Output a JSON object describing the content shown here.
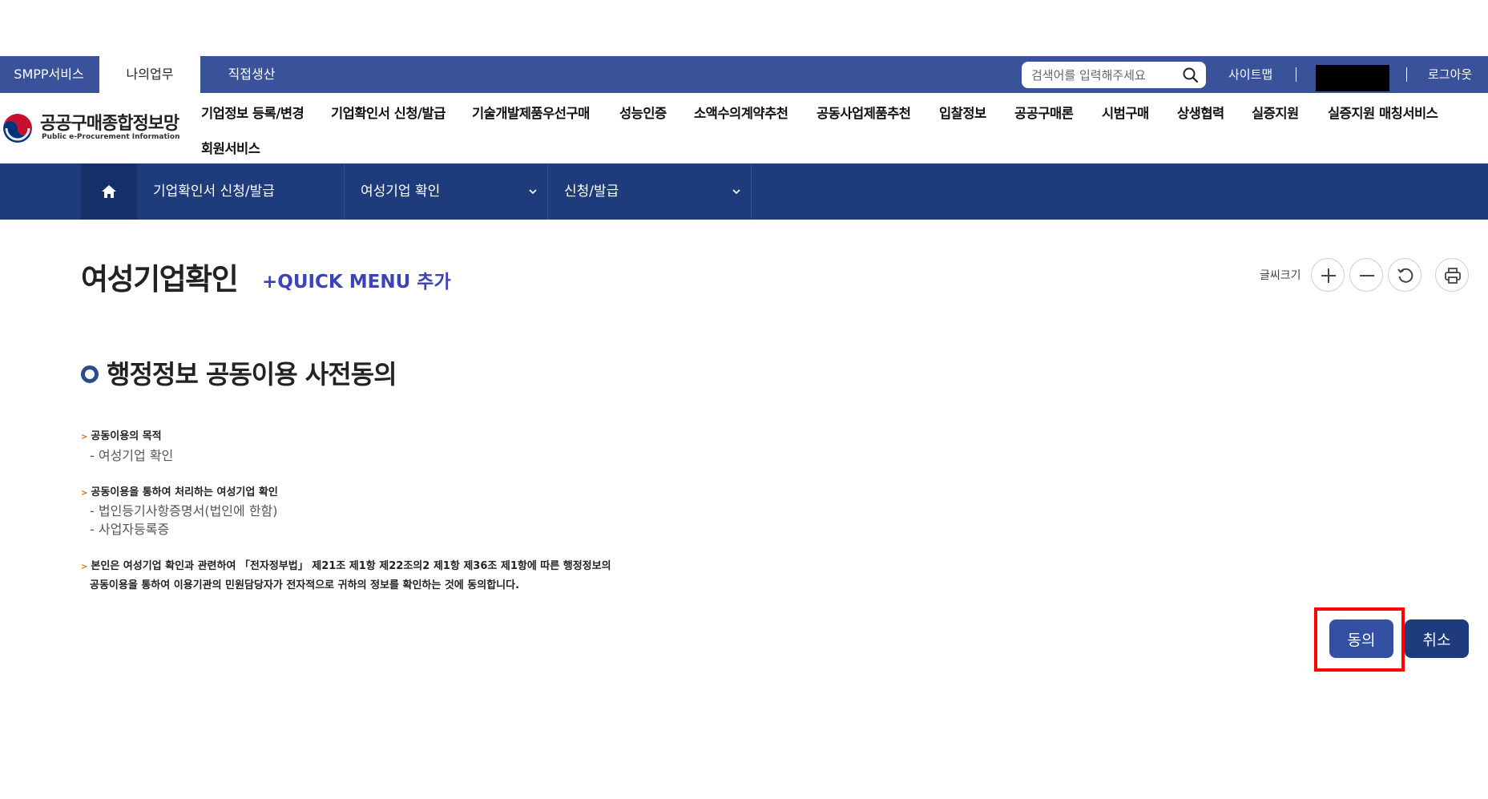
{
  "topbar": {
    "tabs": [
      {
        "label": "SMPP서비스",
        "active": false
      },
      {
        "label": "나의업무",
        "active": true
      },
      {
        "label": "직접생산",
        "active": false
      }
    ],
    "search_placeholder": "검색어를 입력해주세요",
    "sitemap_label": "사이트맵",
    "logout_label": "로그아웃"
  },
  "header": {
    "logo_title": "공공구매종합정보망",
    "logo_subtitle": "Public e-Procurement Information",
    "nav": [
      "기업정보 등록/변경",
      "기업확인서 신청/발급",
      "기술개발제품우선구매",
      "성능인증",
      "소액수의계약추천",
      "공동사업제품추천",
      "입찰정보",
      "공공구매론",
      "시범구매",
      "상생협력",
      "실증지원",
      "실증지원 매칭서비스",
      "회원서비스"
    ]
  },
  "breadcrumb": {
    "level1": "기업확인서 신청/발급",
    "level2": "여성기업 확인",
    "level3": "신청/발급"
  },
  "page": {
    "title": "여성기업확인",
    "quick_menu": "+QUICK MENU 추가",
    "font_size_label": "글씨크기"
  },
  "section": {
    "title": "행정정보 공동이용 사전동의",
    "purpose_head": "공동이용의 목적",
    "purpose_items": [
      "- 여성기업 확인"
    ],
    "docs_head": "공동이용을 통하여 처리하는 여성기업 확인",
    "docs_items": [
      "- 법인등기사항증명서(법인에 한함)",
      "- 사업자등록증"
    ],
    "consent_line1": "본인은 여성기업 확인과 관련하여 「전자정부법」 제21조 제1항 제22조의2 제1항 제36조 제1항에 따른 행정정보의",
    "consent_line2": "공동이용을 통하여 이용기관의 민원담당자가 전자적으로 귀하의 정보를 확인하는 것에 동의합니다."
  },
  "buttons": {
    "agree": "동의",
    "cancel": "취소"
  },
  "colors": {
    "topbar": "#3a5299",
    "breadcrumb": "#1e3c7c",
    "quick_menu": "#3a44b8",
    "accent_arrow": "#e06a1b",
    "highlight": "#ff0000"
  }
}
